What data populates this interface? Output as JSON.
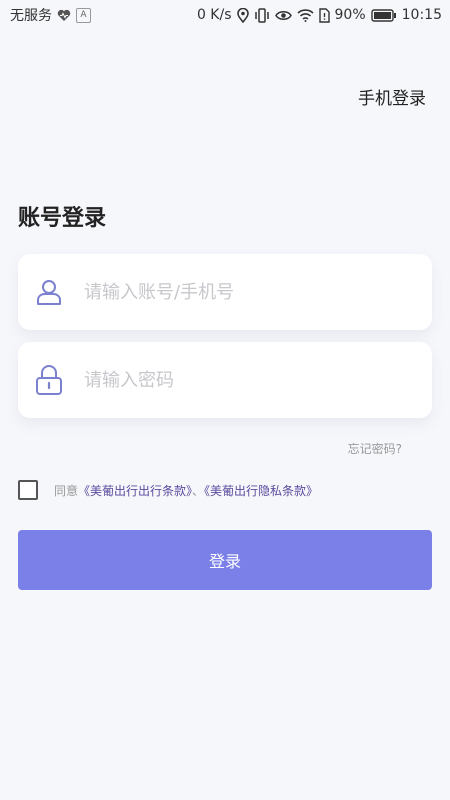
{
  "status_bar": {
    "carrier": "无服务",
    "speed": "0 K/s",
    "battery_percent": "90%",
    "time": "10:15",
    "icons": [
      "heart-icon",
      "a-badge-icon",
      "location-icon",
      "vibrate-icon",
      "eye-icon",
      "wifi-icon",
      "sim-icon",
      "battery-icon"
    ]
  },
  "header": {
    "switch_login_label": "手机登录"
  },
  "page": {
    "title": "账号登录"
  },
  "form": {
    "account_placeholder": "请输入账号/手机号",
    "account_icon": "user-icon",
    "password_placeholder": "请输入密码",
    "password_icon": "lock-icon",
    "forgot_label": "忘记密码?"
  },
  "agreement": {
    "prefix": "同意",
    "terms_link": "《美葡出行出行条款》",
    "separator": "、",
    "privacy_link": "《美葡出行隐私条款》",
    "checked": false
  },
  "submit": {
    "label": "登录"
  },
  "colors": {
    "accent": "#7a80e8",
    "icon": "#7b80cf",
    "link": "#5a4a9e",
    "background": "#f6f7fb"
  }
}
